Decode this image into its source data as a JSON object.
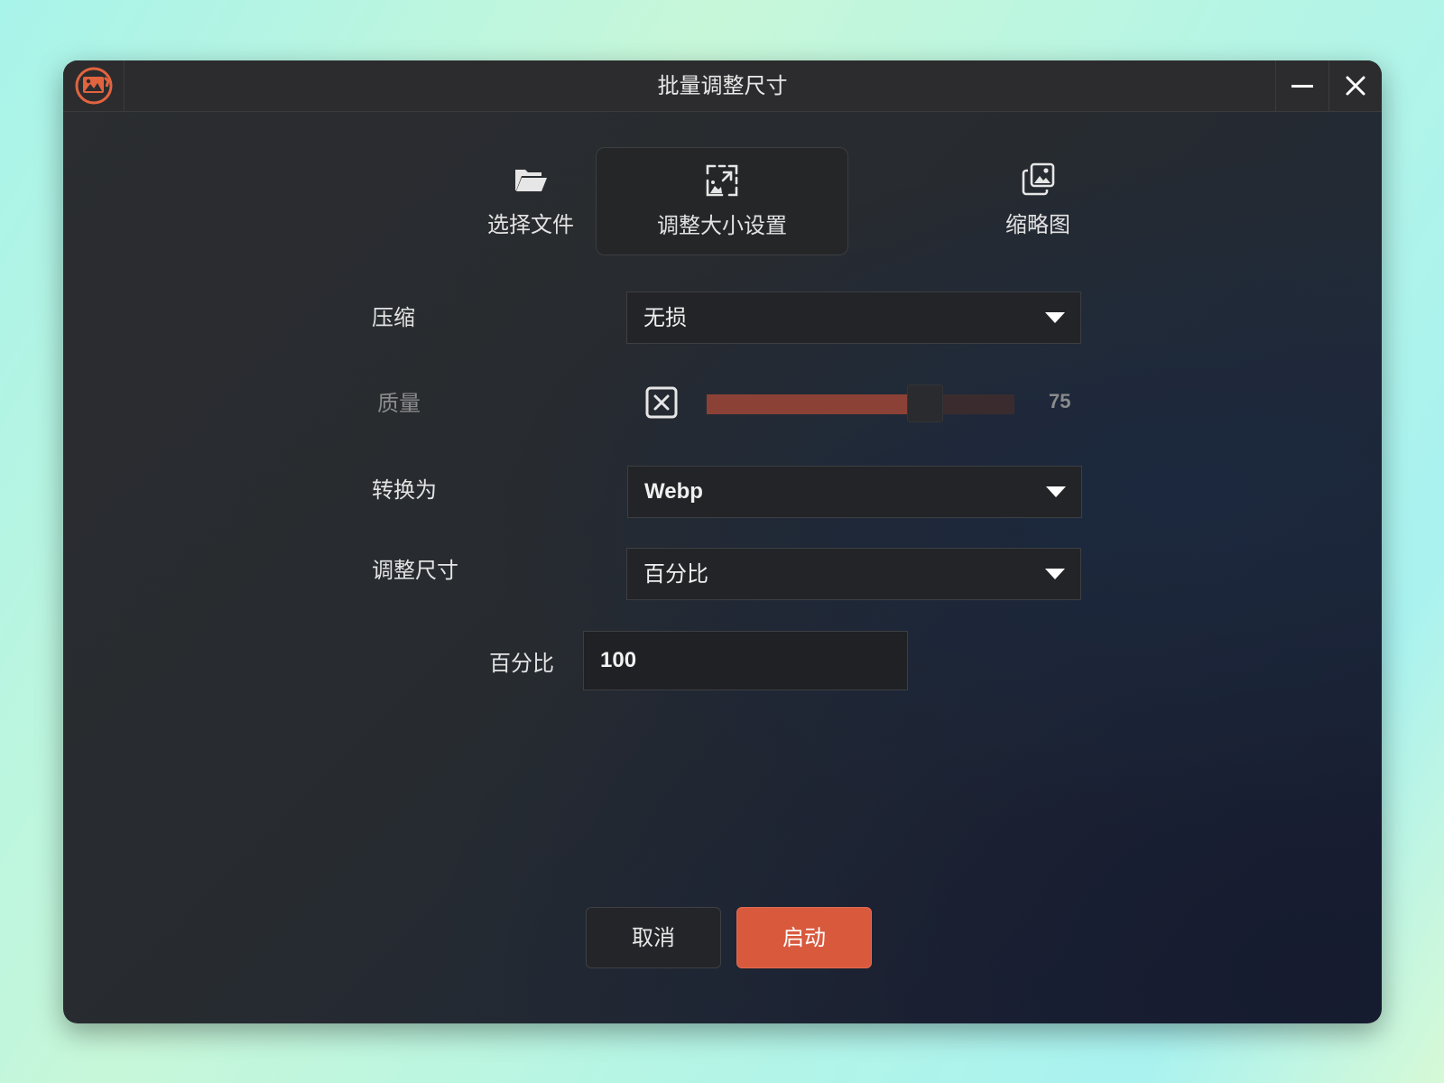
{
  "window": {
    "title": "批量调整尺寸"
  },
  "titlebar": {
    "app_icon": "image-app-icon",
    "minimize_icon": "minimize-icon",
    "close_icon": "close-icon"
  },
  "tabs": [
    {
      "label": "选择文件",
      "icon": "folder-open-icon",
      "active": false
    },
    {
      "label": "调整大小设置",
      "icon": "resize-image-icon",
      "active": true
    },
    {
      "label": "缩略图",
      "icon": "thumbnail-gallery-icon",
      "active": false
    }
  ],
  "form": {
    "compression": {
      "label": "压缩",
      "value": "无损"
    },
    "quality": {
      "label": "质量",
      "value": "75",
      "level": 0.65,
      "checkbox_icon": "x-checkbox-icon"
    },
    "convert_to": {
      "label": "转换为",
      "value": "Webp"
    },
    "resize": {
      "label": "调整尺寸",
      "value": "百分比"
    },
    "percentage": {
      "label": "百分比",
      "value": "100"
    }
  },
  "buttons": {
    "cancel": "取消",
    "start": "启动"
  },
  "colors": {
    "accent": "#d9593d",
    "slider_fill": "#8c4136",
    "window_bg": "#2a2c2f"
  }
}
